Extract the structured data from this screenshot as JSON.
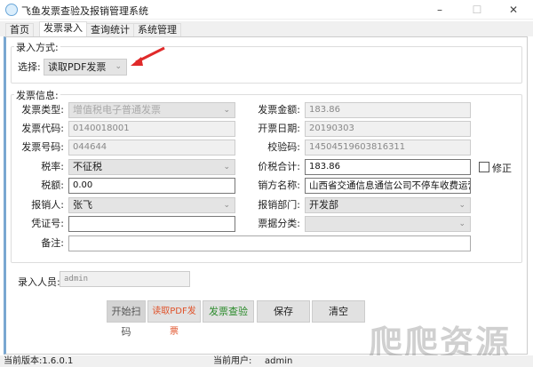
{
  "window": {
    "title": "飞鱼发票查验及报销管理系统",
    "minimize": "–",
    "maximize": "☐",
    "close": "✕"
  },
  "tabs": [
    {
      "label": "首页"
    },
    {
      "label": "发票录入"
    },
    {
      "label": "查询统计"
    },
    {
      "label": "系统管理"
    }
  ],
  "entry_mode": {
    "group_label": "录入方式:",
    "select_label": "选择:",
    "select_value": "读取PDF发票"
  },
  "invoice": {
    "group_label": "发票信息:",
    "type_label": "发票类型:",
    "type_value": "增值税电子普通发票",
    "code_label": "发票代码:",
    "code_value": "0140018001",
    "number_label": "发票号码:",
    "number_value": "044644",
    "rate_label": "税率:",
    "rate_value": "不征税",
    "tax_label": "税额:",
    "tax_value": "0.00",
    "claimant_label": "报销人:",
    "claimant_value": "张飞",
    "voucher_label": "凭证号:",
    "voucher_value": "",
    "remark_label": "备注:",
    "remark_value": "",
    "amount_label": "发票金额:",
    "amount_value": "183.86",
    "date_label": "开票日期:",
    "date_value": "20190303",
    "check_label": "校验码:",
    "check_value": "14504519603816311",
    "total_label": "价税合计:",
    "total_value": "183.86",
    "correct_label": "修正",
    "correct_checked": false,
    "seller_label": "销方名称:",
    "seller_value": "山西省交通信息通信公司不停车收费运营|",
    "dept_label": "报销部门:",
    "dept_value": "开发部",
    "category_label": "票据分类:",
    "category_value": ""
  },
  "operator": {
    "label": "录入人员:",
    "value": "admin"
  },
  "buttons": {
    "scan": "开始扫码",
    "read_pdf": "读取PDF发票",
    "verify": "发票查验",
    "save": "保存",
    "clear": "清空"
  },
  "colors": {
    "read_pdf": "#e0522a",
    "verify": "#2a8a2a",
    "accent": "#7aa7d1"
  },
  "status": {
    "version": "当前版本:1.6.0.1",
    "user_label": "当前用户:",
    "user_value": "admin"
  },
  "watermark": "爬爬资源"
}
